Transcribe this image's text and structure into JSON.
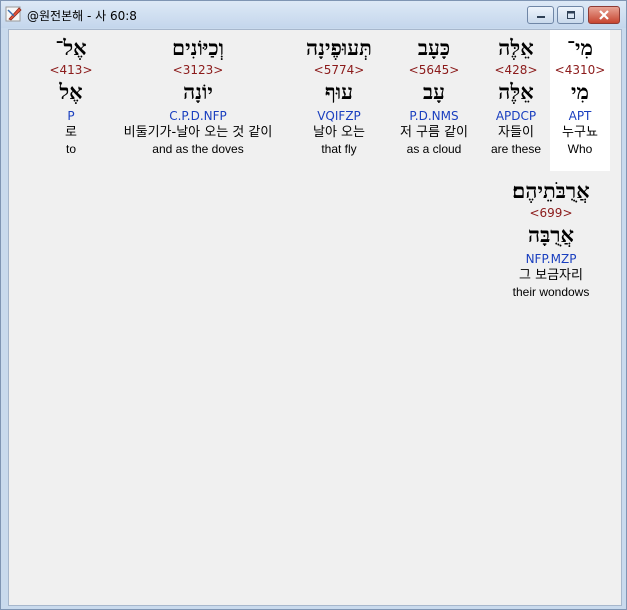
{
  "window": {
    "title": "@원전본해 - 사 60:8",
    "minimize_glyph": "—",
    "maximize_glyph": "□",
    "close_glyph": "✕"
  },
  "words": [
    {
      "hebrew": "מִי־",
      "strong": "<4310>",
      "lemma": "מִי",
      "grammar": "APT",
      "korean": "누구뇨",
      "english": "Who"
    },
    {
      "hebrew": "אֵלֶּה",
      "strong": "<428>",
      "lemma": "אֵלֶּה",
      "grammar": "APDCP",
      "korean": "자들이",
      "english": "are these"
    },
    {
      "hebrew": "כָּעָב",
      "strong": "<5645>",
      "lemma": "עָב",
      "grammar": "P.D.NMS",
      "korean": "저 구름 같이",
      "english": "as a cloud"
    },
    {
      "hebrew": "תְּעוּפֶינָה",
      "strong": "<5774>",
      "lemma": "עוּף",
      "grammar": "VQIFZP",
      "korean": "날아 오는",
      "english": "that fly"
    },
    {
      "hebrew": "וְכַיּוֹנִים",
      "strong": "<3123>",
      "lemma": "יוֹנָה",
      "grammar": "C.P.D.NFP",
      "korean": "비둘기가-날아 오는 것 같이",
      "english": "and as the doves"
    },
    {
      "hebrew": "אֶל־",
      "strong": "<413>",
      "lemma": "אֶל",
      "grammar": "P",
      "korean": "로",
      "english": "to"
    },
    {
      "hebrew": "אֲרֻבֹּתֵיהֶם׃",
      "strong": "<699>",
      "lemma": "אֲרֻבָּה",
      "grammar": "NFP.MZP",
      "korean": "그 보금자리",
      "english": "their wondows"
    }
  ]
}
